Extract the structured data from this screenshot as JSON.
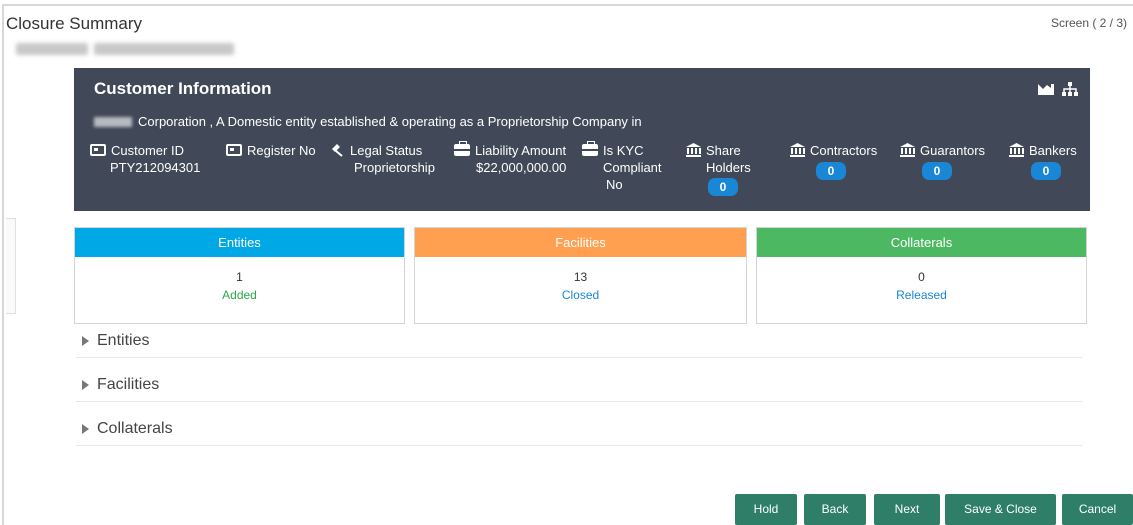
{
  "header": {
    "title": "Closure Summary",
    "screen_indicator": "Screen ( 2 / 3)"
  },
  "customer_info": {
    "title": "Customer Information",
    "description": "Corporation , A Domestic entity established & operating as a Proprietorship Company in",
    "fields": [
      {
        "label": "Customer ID",
        "value": "PTY212094301",
        "icon": "id-card-icon"
      },
      {
        "label": "Register No",
        "value": "",
        "icon": "id-card-icon"
      },
      {
        "label": "Legal Status",
        "value": "Proprietorship",
        "icon": "gavel-icon"
      },
      {
        "label": "Liability Amount",
        "value": "$22,000,000.00",
        "icon": "briefcase-icon"
      },
      {
        "label": "Is KYC Compliant",
        "value": "No",
        "icon": "briefcase-icon"
      },
      {
        "label": "Share Holders",
        "value": "0",
        "icon": "bank-icon"
      },
      {
        "label": "Contractors",
        "value": "0",
        "icon": "bank-icon"
      },
      {
        "label": "Guarantors",
        "value": "0",
        "icon": "bank-icon"
      },
      {
        "label": "Bankers",
        "value": "0",
        "icon": "bank-icon"
      }
    ]
  },
  "summary_cards": [
    {
      "title": "Entities",
      "count": "1",
      "status": "Added",
      "color": "#00a8e6",
      "status_color": "#2aa84a"
    },
    {
      "title": "Facilities",
      "count": "13",
      "status": "Closed",
      "color": "#ff9f4f",
      "status_color": "#1a86d6"
    },
    {
      "title": "Collaterals",
      "count": "0",
      "status": "Released",
      "color": "#4cb862",
      "status_color": "#1a86d6"
    }
  ],
  "sections": [
    "Entities",
    "Facilities",
    "Collaterals"
  ],
  "buttons": {
    "hold": "Hold",
    "back": "Back",
    "next": "Next",
    "save_close": "Save & Close",
    "cancel": "Cancel"
  },
  "colors": {
    "panel_bg": "#414857",
    "button_bg": "#2f7e67",
    "badge_bg": "#1a86d6"
  }
}
